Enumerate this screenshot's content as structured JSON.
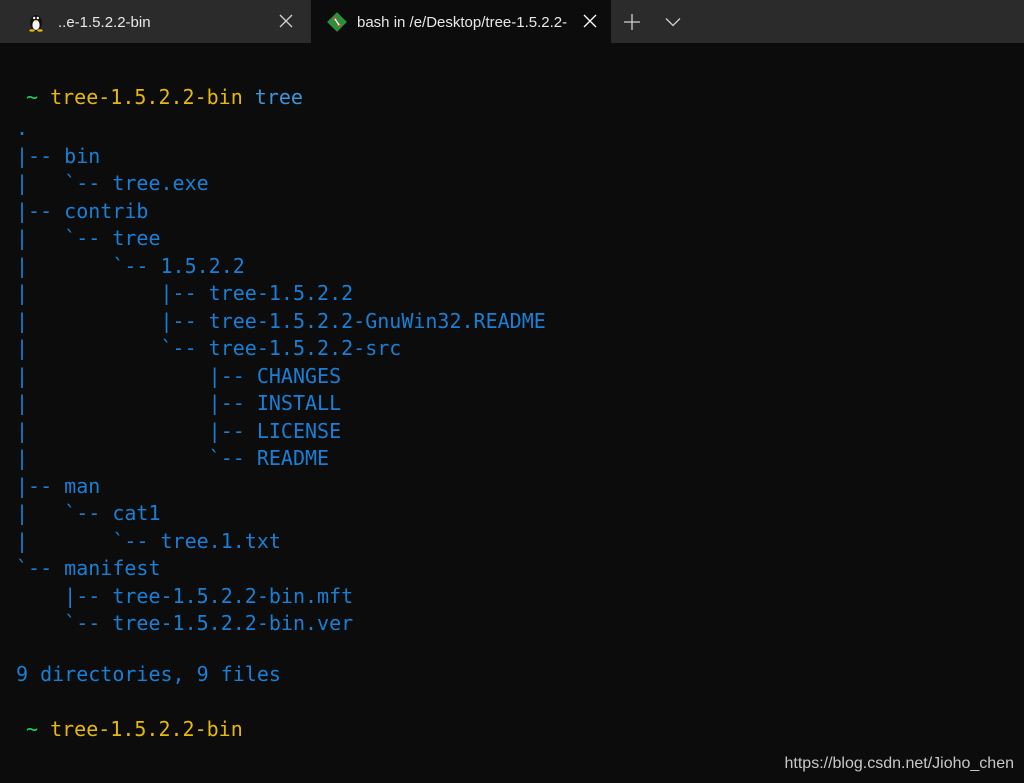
{
  "tabs": [
    {
      "title": "..e-1.5.2.2-bin",
      "icon": "linux-penguin-icon",
      "active": false
    },
    {
      "title": "bash in /e/Desktop/tree-1.5.2.2-",
      "icon": "git-bash-icon",
      "active": true
    }
  ],
  "prompt": {
    "tilde": "~",
    "directory": "tree-1.5.2.2-bin",
    "command": "tree"
  },
  "tree_lines": [
    ".",
    "|-- bin",
    "|   `-- tree.exe",
    "|-- contrib",
    "|   `-- tree",
    "|       `-- 1.5.2.2",
    "|           |-- tree-1.5.2.2",
    "|           |-- tree-1.5.2.2-GnuWin32.README",
    "|           `-- tree-1.5.2.2-src",
    "|               |-- CHANGES",
    "|               |-- INSTALL",
    "|               |-- LICENSE",
    "|               `-- README",
    "|-- man",
    "|   `-- cat1",
    "|       `-- tree.1.txt",
    "`-- manifest",
    "    |-- tree-1.5.2.2-bin.mft",
    "    `-- tree-1.5.2.2-bin.ver"
  ],
  "summary": "9 directories, 9 files",
  "prompt2": {
    "tilde": "~",
    "directory": "tree-1.5.2.2-bin"
  },
  "watermark": "https://blog.csdn.net/Jioho_chen",
  "colors": {
    "tab_active_bg": "#0c0c0c",
    "tab_bar_bg": "#2b2b2b",
    "terminal_bg": "#0c0c0c",
    "prompt_tilde": "#13d46b",
    "prompt_dir": "#e5b80b",
    "tree_text": "#1a7fd4"
  }
}
